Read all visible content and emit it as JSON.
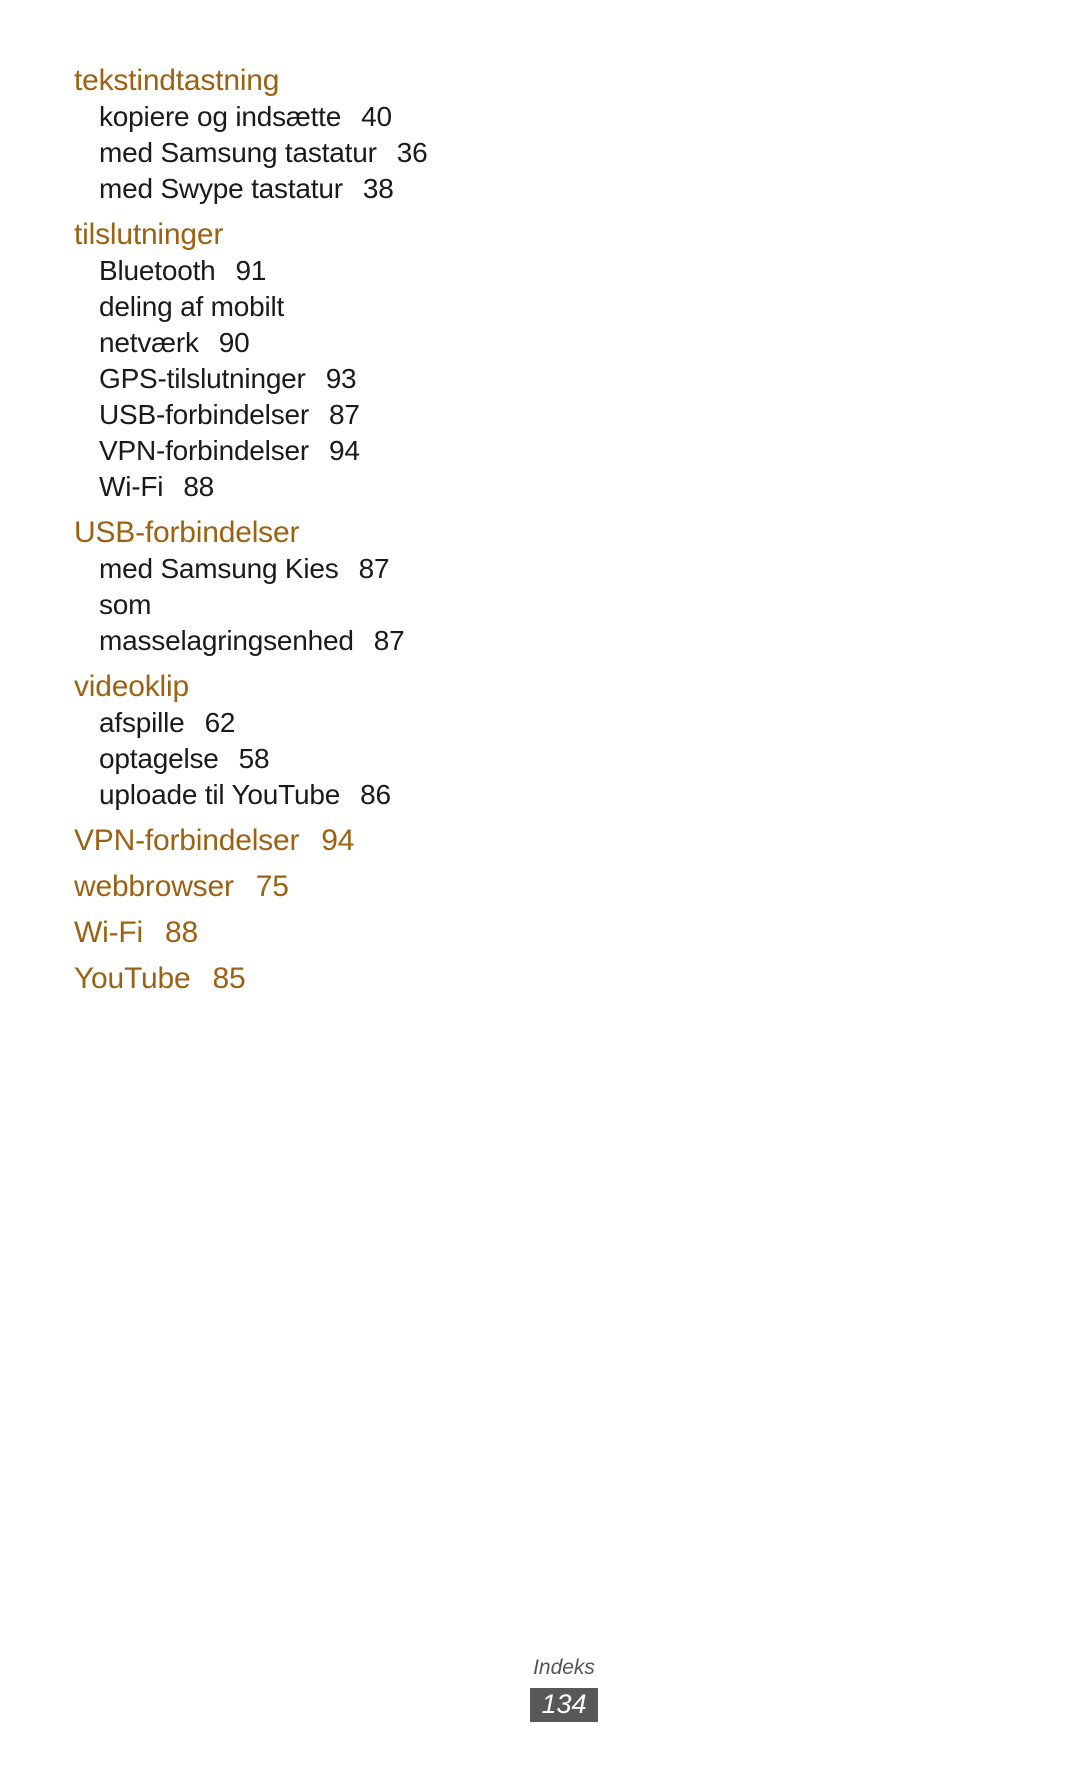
{
  "document": {
    "type": "index-page",
    "language": "da",
    "heading_color": "#9c6214",
    "text_color": "#1a1a1a"
  },
  "index": {
    "groups": [
      {
        "heading": "tekstindtastning",
        "heading_page": "",
        "entries": [
          {
            "label": "kopiere og indsætte",
            "page": "40",
            "cont": ""
          },
          {
            "label": "med Samsung tastatur",
            "page": "36",
            "cont": ""
          },
          {
            "label": "med Swype tastatur",
            "page": "38",
            "cont": ""
          }
        ]
      },
      {
        "heading": "tilslutninger",
        "heading_page": "",
        "entries": [
          {
            "label": "Bluetooth",
            "page": "91",
            "cont": ""
          },
          {
            "label": "deling af mobilt",
            "page": "90",
            "cont": "netværk"
          },
          {
            "label": "GPS-tilslutninger",
            "page": "93",
            "cont": ""
          },
          {
            "label": "USB-forbindelser",
            "page": "87",
            "cont": ""
          },
          {
            "label": "VPN-forbindelser",
            "page": "94",
            "cont": ""
          },
          {
            "label": "Wi-Fi",
            "page": "88",
            "cont": ""
          }
        ]
      },
      {
        "heading": "USB-forbindelser",
        "heading_page": "",
        "entries": [
          {
            "label": "med Samsung Kies",
            "page": "87",
            "cont": ""
          },
          {
            "label": "som",
            "page": "87",
            "cont": "masselagringsenhed"
          }
        ]
      },
      {
        "heading": "videoklip",
        "heading_page": "",
        "entries": [
          {
            "label": "afspille",
            "page": "62",
            "cont": ""
          },
          {
            "label": "optagelse",
            "page": "58",
            "cont": ""
          },
          {
            "label": "uploade til YouTube",
            "page": "86",
            "cont": ""
          }
        ]
      },
      {
        "heading": "VPN-forbindelser",
        "heading_page": "94",
        "entries": []
      },
      {
        "heading": "webbrowser",
        "heading_page": "75",
        "entries": []
      },
      {
        "heading": "Wi-Fi",
        "heading_page": "88",
        "entries": []
      },
      {
        "heading": "YouTube",
        "heading_page": "85",
        "entries": []
      }
    ]
  },
  "footer": {
    "label": "Indeks",
    "page_number": "134",
    "page_box_color": "#585858"
  }
}
